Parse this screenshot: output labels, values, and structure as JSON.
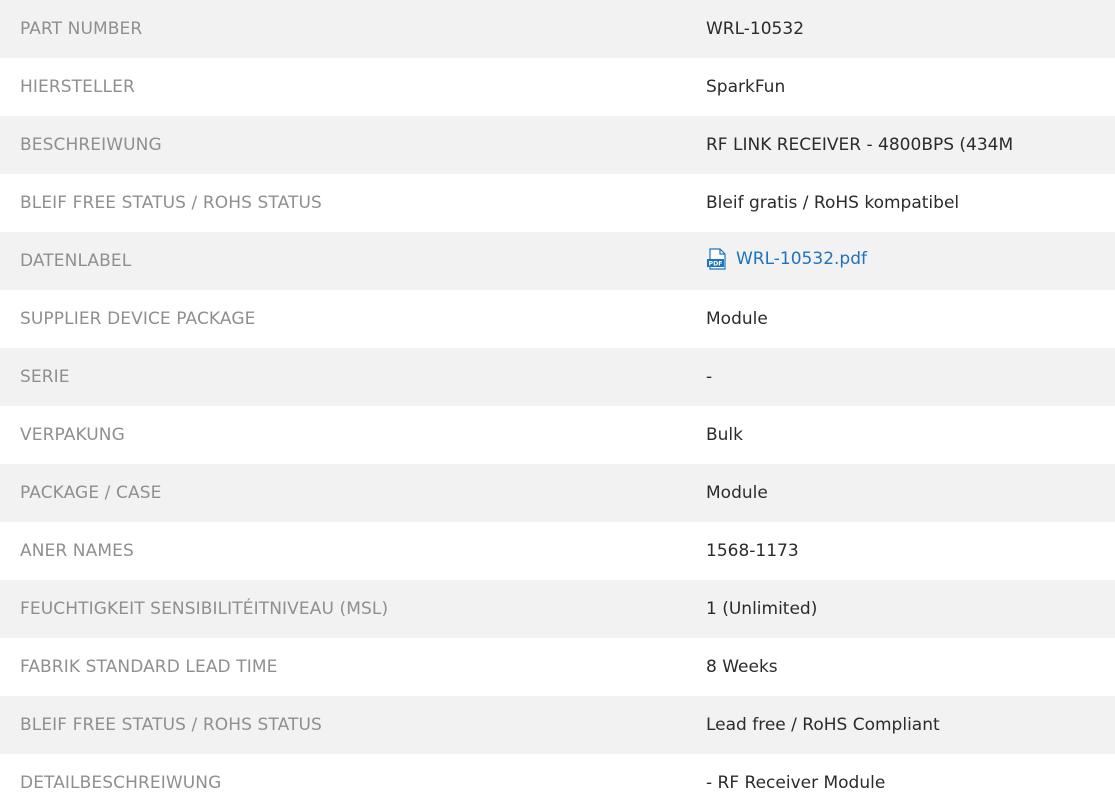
{
  "rows": [
    {
      "label": "PART NUMBER",
      "value": "WRL-10532"
    },
    {
      "label": "HIERSTELLER",
      "value": "SparkFun"
    },
    {
      "label": "BESCHREIWUNG",
      "value": "RF LINK RECEIVER - 4800BPS (434M"
    },
    {
      "label": "BLEIF FREE STATUS / ROHS STATUS",
      "value": "Bleif gratis / RoHS kompatibel"
    },
    {
      "label": "DATENLABEL",
      "value": "WRL-10532.pdf",
      "icon": "pdf-icon",
      "link_color": "#1e73be"
    },
    {
      "label": "SUPPLIER DEVICE PACKAGE",
      "value": "Module"
    },
    {
      "label": "SERIE",
      "value": "-"
    },
    {
      "label": "VERPAKUNG",
      "value": "Bulk"
    },
    {
      "label": "PACKAGE / CASE",
      "value": "Module"
    },
    {
      "label": "ANER NAMES",
      "value": "1568-1173"
    },
    {
      "label": "FEUCHTIGKEIT SENSIBILITÉITNIVEAU (MSL)",
      "value": "1 (Unlimited)"
    },
    {
      "label": "FABRIK STANDARD LEAD TIME",
      "value": "8 Weeks"
    },
    {
      "label": "BLEIF FREE STATUS / ROHS STATUS",
      "value": "Lead free / RoHS Compliant"
    },
    {
      "label": "DETAILBESCHREIWUNG",
      "value": "- RF Receiver Module"
    }
  ],
  "colors": {
    "row_alt": "#f2f2f2",
    "label_text": "#8f8f8f",
    "value_text": "#2b2b2b",
    "link": "#1e73be"
  }
}
